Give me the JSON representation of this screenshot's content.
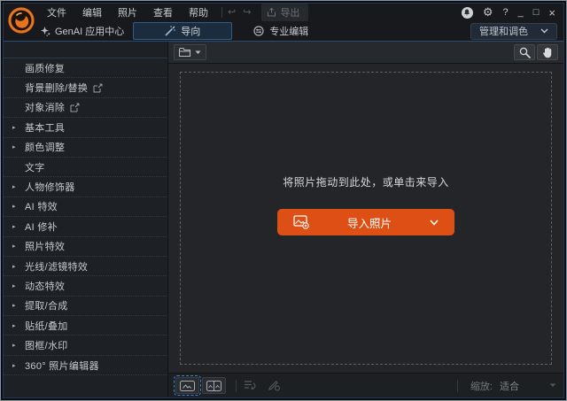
{
  "titlebar": {
    "menus": [
      "文件",
      "编辑",
      "照片",
      "查看",
      "帮助"
    ],
    "undo_glyph": "↩",
    "redo_glyph": "↪",
    "export_label": "导出",
    "window_controls": {
      "help": "?",
      "minimize": "_",
      "maximize": "□",
      "close": "×",
      "gear": "⚙"
    }
  },
  "nav": {
    "genai_label": "GenAI 应用中心",
    "guide_tab_label": "导向",
    "pro_edit_label": "专业编辑",
    "workspace_dropdown_label": "管理和调色"
  },
  "sidebar": {
    "items": [
      {
        "arrow": "",
        "label": "画质修复"
      },
      {
        "arrow": "",
        "label": "背景删除/替换"
      },
      {
        "arrow": "",
        "label": "对象消除"
      },
      {
        "arrow": "▸",
        "label": "基本工具"
      },
      {
        "arrow": "▸",
        "label": "颜色调整"
      },
      {
        "arrow": "",
        "label": "文字"
      },
      {
        "arrow": "▸",
        "label": "人物修饰器"
      },
      {
        "arrow": "▸",
        "label": "AI 特效"
      },
      {
        "arrow": "▸",
        "label": "AI 修补"
      },
      {
        "arrow": "▸",
        "label": "照片特效"
      },
      {
        "arrow": "▸",
        "label": "光线/滤镜特效"
      },
      {
        "arrow": "▸",
        "label": "动态特效"
      },
      {
        "arrow": "▸",
        "label": "提取/合成"
      },
      {
        "arrow": "▸",
        "label": "贴纸/叠加"
      },
      {
        "arrow": "▸",
        "label": "图框/水印"
      },
      {
        "arrow": "▸",
        "label": "360° 照片编辑器"
      }
    ]
  },
  "canvas": {
    "dropzone_text": "将照片拖动到此处，或单击来导入",
    "import_button_label": "导入照片"
  },
  "statusbar": {
    "zoom_label": "缩放:",
    "zoom_value": "适合"
  },
  "colors": {
    "accent_orange": "#dd4f14",
    "tab_active_border": "#2e5d8d"
  }
}
